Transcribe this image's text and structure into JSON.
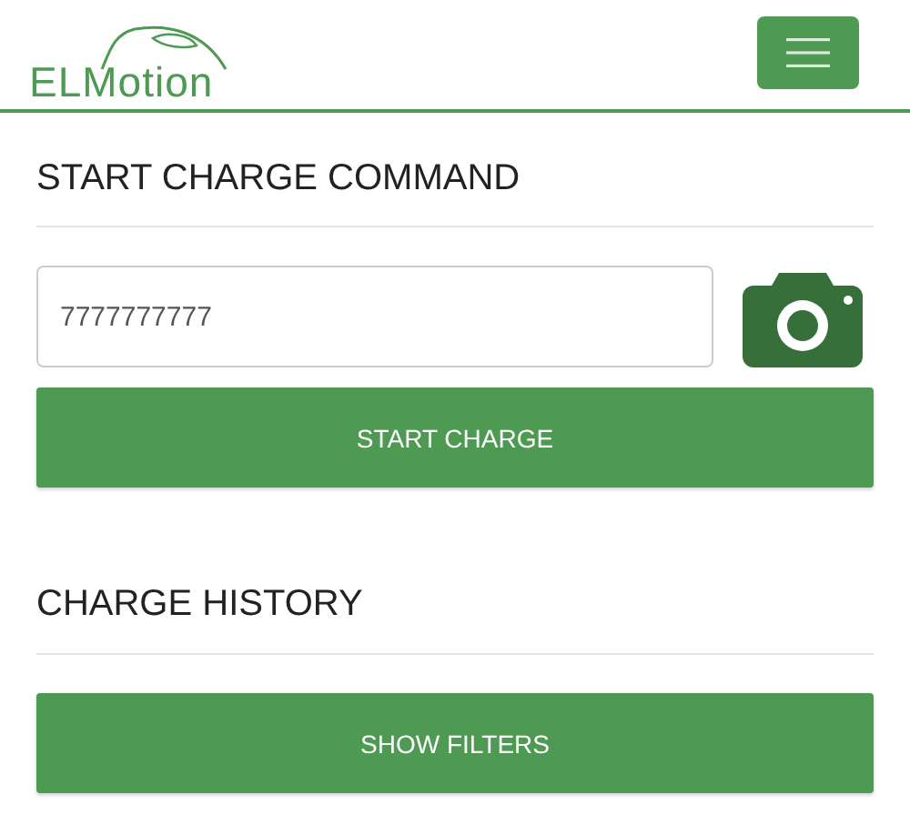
{
  "header": {
    "logo": "ELMotion"
  },
  "start_charge": {
    "title": "START CHARGE COMMAND",
    "input_value": "7777777777",
    "button": "START CHARGE"
  },
  "history": {
    "title": "CHARGE HISTORY",
    "button": "SHOW FILTERS"
  }
}
